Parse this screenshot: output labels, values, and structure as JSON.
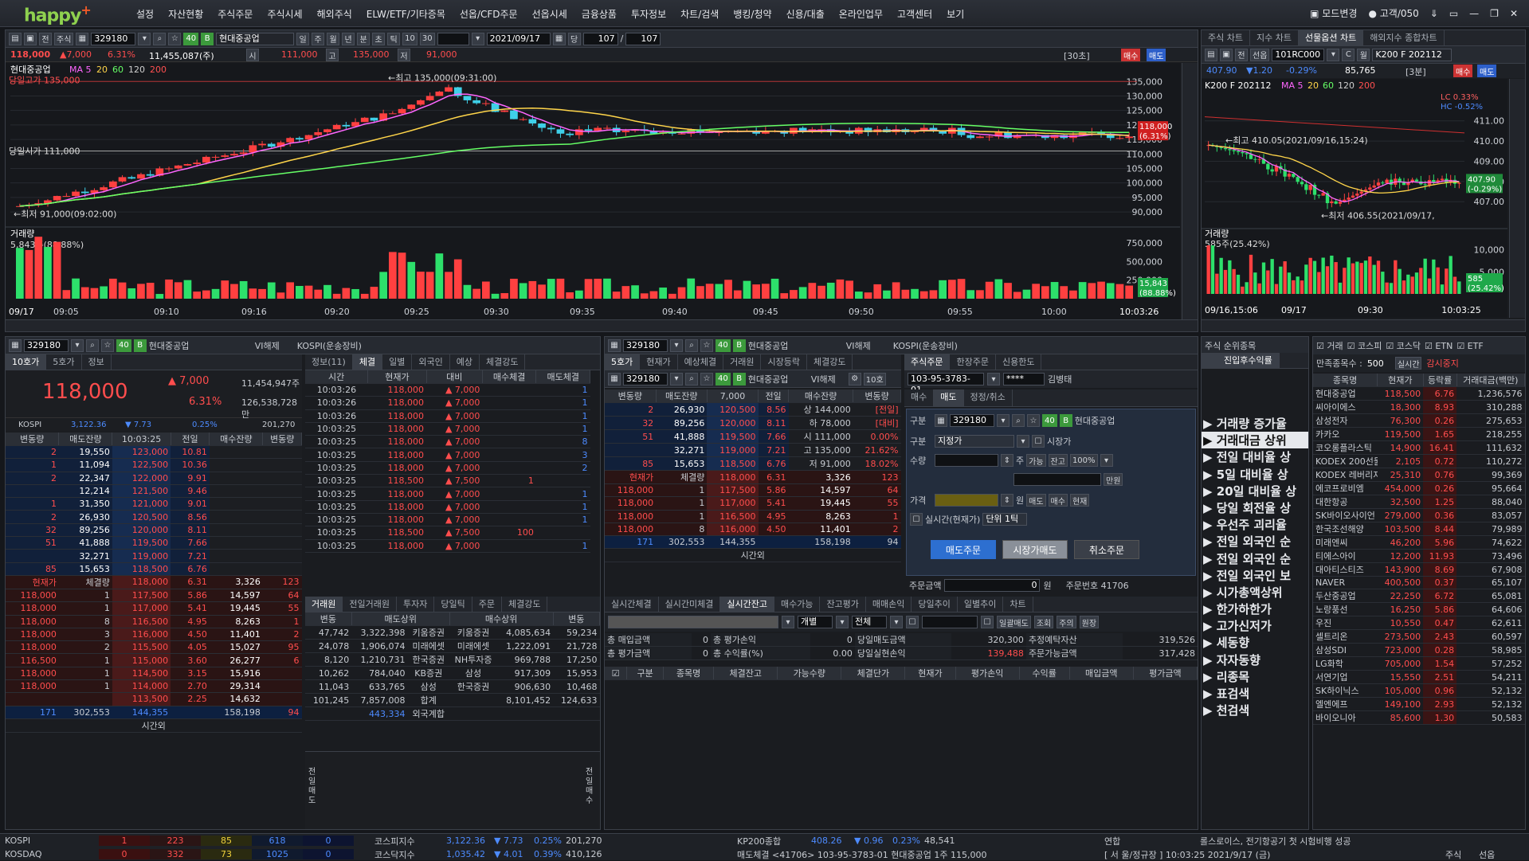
{
  "app": {
    "logo": "happy",
    "logo_plus": "+"
  },
  "menu": [
    "설정",
    "자산현황",
    "주식주문",
    "주식시세",
    "해외주식",
    "ELW/ETF/기타증목",
    "선옵/CFD주문",
    "선옵시세",
    "금융상품",
    "투자정보",
    "차트/검색",
    "뱅킹/청약",
    "신용/대출",
    "온라인업무",
    "고객센터",
    "보기"
  ],
  "menu_right": {
    "mode": "모드변경",
    "customer": "고객/050"
  },
  "main_chart": {
    "code": "329180",
    "name": "현대중공업",
    "count": "107",
    "count2": "107",
    "date": "2021/09/17",
    "unit": "당",
    "periods": [
      "일",
      "주",
      "월",
      "년",
      "분",
      "초",
      "틱"
    ],
    "p1": "10",
    "p2": "30",
    "price": "118,000",
    "change": "▲7,000",
    "pct": "6.31%",
    "volume": "11,455,087(주)",
    "open_label": "시",
    "open": "111,000",
    "high_label": "고",
    "high": "135,000",
    "low_label": "저",
    "low": "91,000",
    "interval": "[30초]",
    "buy": "매수",
    "sell": "매도",
    "legend_name": "현대중공업",
    "ma": [
      "MA 5",
      "20",
      "60",
      "120",
      "200"
    ],
    "high_note": "당일고가 135,000",
    "open_note": "당일시가 111,000",
    "max_note": "←최고 135,000(09:31:00)",
    "min_note": "←최저 91,000(09:02:00)",
    "yticks": [
      "135,000",
      "130,000",
      "125,000",
      "120,000",
      "115,000",
      "110,000",
      "105,000",
      "100,000",
      "95,000",
      "90,000"
    ],
    "cur_label": "118,000",
    "cur_pct": "(6.31%)",
    "vol_title": "거래량",
    "vol_note": "5,843주(88.88%)",
    "vol_ticks": [
      "750,000",
      "500,000",
      "250,000"
    ],
    "vol_cur": "15,843",
    "vol_cur_pct": "(88.88%)",
    "xticks": [
      "09/17",
      "09:05",
      "09:10",
      "09:16",
      "09:20",
      "09:25",
      "09:30",
      "09:35",
      "09:40",
      "09:45",
      "09:50",
      "09:55",
      "10:00",
      "10:03:26"
    ]
  },
  "side_chart": {
    "tabs": [
      "주식 차트",
      "지수 차트",
      "선물옵션 차트",
      "해외지수 종합차트"
    ],
    "code": "101RC000",
    "name": "K200 F 202112",
    "price": "407.90",
    "change": "▼1.20",
    "pct": "-0.29%",
    "vol": "85,765",
    "interval": "[3분]",
    "buy": "매수",
    "sell": "매도",
    "legend": "K200 F 202112",
    "ma": [
      "MA 5",
      "20",
      "60",
      "120",
      "200"
    ],
    "lc": "LC 0.33%",
    "hc": "HC -0.52%",
    "max_note": "←최고 410.05(2021/09/16,15:24)",
    "min_note": "←최저 406.55(2021/09/17,",
    "yticks": [
      "411.00",
      "410.00",
      "409.00",
      "408.00",
      "407.00"
    ],
    "cur": "407.90",
    "cur_pct": "(-0.29%)",
    "vol_title": "거래량",
    "vol_note": "585주(25.42%)",
    "vol_ticks": [
      "10,000",
      "5,000"
    ],
    "vol_cur": "585",
    "vol_cur_pct": "(25.42%)",
    "xticks": [
      "09/16,15:06",
      "09/17",
      "09:30",
      "10:03:25"
    ]
  },
  "orderbook": {
    "code": "329180",
    "name": "현대중공업",
    "vi": "VI해제",
    "market": "KOSPI(운송장비)",
    "tabs": [
      "10호가",
      "5호가",
      "정보"
    ],
    "price": "118,000",
    "change": "▲ 7,000",
    "pct": "6.31%",
    "vol": "11,454,947주",
    "amount": "126,538,728만",
    "kospi_label": "KOSPI",
    "kospi": "3,122.36",
    "kospi_chg": "▼ 7.73",
    "kospi_pct": "0.25%",
    "kospi_vol": "201,270",
    "hdr": [
      "변동량",
      "매도잔량",
      "10:03:25",
      "전일",
      "매수잔량",
      "변동량"
    ],
    "asks": [
      [
        "2",
        "19,550",
        "123,000",
        "10.81"
      ],
      [
        "1",
        "11,094",
        "122,500",
        "10.36"
      ],
      [
        "2",
        "22,347",
        "122,000",
        "9.91"
      ],
      [
        "",
        "12,214",
        "121,500",
        "9.46"
      ],
      [
        "1",
        "31,350",
        "121,000",
        "9.01"
      ],
      [
        "2",
        "26,930",
        "120,500",
        "8.56"
      ],
      [
        "32",
        "89,256",
        "120,000",
        "8.11"
      ],
      [
        "51",
        "41,888",
        "119,500",
        "7.66"
      ],
      [
        "",
        "32,271",
        "119,000",
        "7.21"
      ],
      [
        "85",
        "15,653",
        "118,500",
        "6.76"
      ]
    ],
    "bids": [
      [
        "118,000",
        "6.31",
        "3,326",
        "123"
      ],
      [
        "117,500",
        "5.86",
        "14,597",
        "64"
      ],
      [
        "117,000",
        "5.41",
        "19,445",
        "55"
      ],
      [
        "116,500",
        "4.95",
        "8,263",
        "1"
      ],
      [
        "116,000",
        "4.50",
        "11,401",
        "2"
      ],
      [
        "115,500",
        "4.05",
        "15,027",
        "95"
      ],
      [
        "115,000",
        "3.60",
        "26,277",
        "6"
      ],
      [
        "114,500",
        "3.15",
        "15,916",
        ""
      ],
      [
        "114,000",
        "2.70",
        "29,314",
        ""
      ],
      [
        "113,500",
        "2.25",
        "14,632",
        ""
      ]
    ],
    "trades_hdr": [
      "현재가",
      "체결량"
    ],
    "trades": [
      [
        "118,000",
        "1"
      ],
      [
        "118,000",
        "1"
      ],
      [
        "118,000",
        "1"
      ],
      [
        "118,000",
        "8"
      ],
      [
        "118,000",
        "3"
      ],
      [
        "118,000",
        "2"
      ],
      [
        "116,500",
        "1"
      ],
      [
        "118,000",
        "1"
      ],
      [
        "118,000",
        "1"
      ]
    ],
    "tot": [
      "171",
      "302,553",
      "144,355",
      "158,198",
      "94"
    ],
    "after": "시간외"
  },
  "ticks": {
    "tabs": [
      "정보(11)",
      "체결",
      "일별",
      "외국인",
      "예상",
      "체결강도"
    ],
    "hdr": [
      "시간",
      "현재가",
      "대비",
      "매수체결",
      "매도체결"
    ],
    "rows": [
      [
        "10:03:26",
        "118,000",
        "7,000",
        "",
        "1"
      ],
      [
        "10:03:26",
        "118,000",
        "7,000",
        "",
        "1"
      ],
      [
        "10:03:26",
        "118,000",
        "7,000",
        "",
        "1"
      ],
      [
        "10:03:25",
        "118,000",
        "7,000",
        "",
        "1"
      ],
      [
        "10:03:25",
        "118,000",
        "7,000",
        "",
        "8"
      ],
      [
        "10:03:25",
        "118,000",
        "7,000",
        "",
        "3"
      ],
      [
        "10:03:25",
        "118,000",
        "7,000",
        "",
        "2"
      ],
      [
        "10:03:25",
        "118,500",
        "7,500",
        "1",
        ""
      ],
      [
        "10:03:25",
        "118,000",
        "7,000",
        "",
        "1"
      ],
      [
        "10:03:25",
        "118,000",
        "7,000",
        "",
        "1"
      ],
      [
        "10:03:25",
        "118,000",
        "7,000",
        "",
        "1"
      ],
      [
        "10:03:25",
        "118,500",
        "7,500",
        "100",
        ""
      ],
      [
        "10:03:25",
        "118,000",
        "7,000",
        "",
        "1"
      ]
    ]
  },
  "broker": {
    "tabs": [
      "거래원",
      "전일거래원",
      "투자자",
      "당일틱",
      "주문",
      "체결강도"
    ],
    "hdr": [
      "변동",
      "매도상위",
      "매수상위",
      "변동"
    ],
    "rows": [
      [
        "47,742",
        "3,322,398",
        "키움증권",
        "키움증권",
        "4,085,634",
        "59,234"
      ],
      [
        "24,078",
        "1,906,074",
        "미래에셋",
        "미래에셋",
        "1,222,091",
        "21,728"
      ],
      [
        "8,120",
        "1,210,731",
        "한국증권",
        "NH투자증",
        "969,788",
        "17,250"
      ],
      [
        "10,262",
        "784,040",
        "KB증권",
        "삼성",
        "917,309",
        "15,953"
      ],
      [
        "11,043",
        "633,765",
        "삼성",
        "한국증권",
        "906,630",
        "10,468"
      ],
      [
        "101,245",
        "7,857,008",
        "합계",
        "",
        "8,101,452",
        "124,633"
      ],
      [
        "",
        "443,334",
        "외국계합",
        "",
        "",
        ""
      ]
    ],
    "left_v": "전일매도",
    "right_v": "전일매수"
  },
  "ob2": {
    "tabs": [
      "5호가",
      "현재가",
      "예상체결",
      "거래원",
      "시장등락",
      "체결강도"
    ],
    "code": "329180",
    "name": "현대중공업",
    "vi": "VI해제",
    "tick": "10호",
    "hdr": [
      "변동량",
      "매도잔량",
      "7,000",
      "전일",
      "매수잔량",
      "변동량"
    ],
    "asks": [
      [
        "2",
        "26,930",
        "120,500",
        "8.56"
      ],
      [
        "32",
        "89,256",
        "120,000",
        "8.11"
      ],
      [
        "51",
        "41,888",
        "119,500",
        "7.66"
      ],
      [
        "",
        "32,271",
        "119,000",
        "7.21"
      ],
      [
        "85",
        "15,653",
        "118,500",
        "6.76"
      ]
    ],
    "info": [
      [
        "상",
        "144,000"
      ],
      [
        "하",
        "78,000"
      ],
      [
        "시",
        "111,000"
      ],
      [
        "고",
        "135,000"
      ],
      [
        "저",
        "91,000"
      ]
    ],
    "info2": [
      "[전일]",
      "[대비]",
      "0.00%",
      "21.62%",
      "18.02%"
    ],
    "bids": [
      [
        "118,000",
        "6.31",
        "3,326",
        "123"
      ],
      [
        "117,500",
        "5.86",
        "14,597",
        "64"
      ],
      [
        "117,000",
        "5.41",
        "19,445",
        "55"
      ],
      [
        "116,500",
        "4.95",
        "8,263",
        "1"
      ],
      [
        "116,000",
        "4.50",
        "11,401",
        "2"
      ]
    ],
    "trades": [
      [
        "118,000",
        "1"
      ],
      [
        "118,000",
        "1"
      ],
      [
        "118,000",
        "1"
      ],
      [
        "118,000",
        "8"
      ]
    ],
    "tot": [
      "171",
      "302,553",
      "144,355",
      "158,198",
      "94"
    ],
    "after": "시간외"
  },
  "order": {
    "tabs": [
      "주식주문",
      "한장주문",
      "신용한도"
    ],
    "account": "103-95-3783-01",
    "pw": "****",
    "owner": "김병태",
    "sub": [
      "매수",
      "매도",
      "정정/취소"
    ],
    "modes": [
      "일반",
      "신용",
      "주의"
    ],
    "code": "329180",
    "name": "현대중공업",
    "type_label": "구분",
    "type": "지정가",
    "market_time": "시장가",
    "qty_label": "수량",
    "unit": "주",
    "avail": "가능",
    "bal": "잔고",
    "pct": "100%",
    "won_unit": "만원",
    "price_label": "가격",
    "won": "원",
    "sell_btn": "매도",
    "buy_btn": "매수",
    "cur_btn": "현재",
    "realtime": "실시간(현재가)",
    "tick_step": "단위 1틱",
    "btn_sell": "매도주문",
    "btn_mkt": "시장가매도",
    "btn_cancel": "취소주문",
    "amount_label": "주문금액",
    "amount": "0",
    "amount_unit": "원",
    "ordno": "주문번호 41706"
  },
  "balance": {
    "tabs": [
      "실시간체결",
      "실시간미체결",
      "실시간잔고",
      "매수가능",
      "잔고평가",
      "매매손익",
      "당일추이",
      "일별추이",
      "차트"
    ],
    "opt1": "개별",
    "opt2": "전체",
    "opt3": "일괄매도",
    "btn_q": "조회",
    "btn_n": "주의",
    "btn_w": "원장",
    "r1": [
      [
        "총 매입금액",
        "0"
      ],
      [
        "총 평가손익",
        "0"
      ],
      [
        "당일매도금액",
        "320,300"
      ],
      [
        "추정예탁자산",
        "319,526"
      ]
    ],
    "r2": [
      [
        "총 평가금액",
        "0"
      ],
      [
        "총 수익률(%)",
        "0.00"
      ],
      [
        "당일실현손익",
        "139,488"
      ],
      [
        "주문가능금액",
        "317,428"
      ]
    ],
    "hdr": [
      "구분",
      "종목명",
      "체결잔고",
      "가능수량",
      "체결단가",
      "현재가",
      "평가손익",
      "수익률",
      "매입금액",
      "평가금액"
    ]
  },
  "rank": {
    "title": "주식 순위종목",
    "tab": "진입후수익률",
    "items": [
      "거래량 증가율",
      "거래대금 상위",
      "전일 대비율 상",
      "5일 대비율 상",
      "20일 대비율 상",
      "당일 회전율 상",
      "우선주 괴리율",
      "전일 외국인 순",
      "전일 외국인 순",
      "전일 외국인 보",
      "시가총액상위",
      "한가하한가",
      "고가신저가",
      "세동향",
      "자자동향",
      "리종목",
      "표검색",
      "천검색"
    ]
  },
  "list": {
    "filters": [
      "거래",
      "코스피",
      "코스닥",
      "ETN",
      "ETF"
    ],
    "count_label": "만족종목수 :",
    "count": "500",
    "rt": "실시간",
    "stop": "감시중지",
    "hdr": [
      "종목명",
      "현재가",
      "등락률",
      "거래대금(백만)"
    ],
    "rows": [
      [
        "현대중공업",
        "118,500",
        "6.76",
        "1,236,576"
      ],
      [
        "씨아이에스",
        "18,300",
        "8.93",
        "310,288"
      ],
      [
        "삼성전자",
        "76,300",
        "0.26",
        "275,653"
      ],
      [
        "카카오",
        "119,500",
        "1.65",
        "218,255"
      ],
      [
        "코오롱플라스틱",
        "14,900",
        "16.41",
        "111,632"
      ],
      [
        "KODEX 200선물",
        "2,105",
        "0.72",
        "110,272"
      ],
      [
        "KODEX 레버리지",
        "25,310",
        "0.76",
        "99,369"
      ],
      [
        "에코프로비엠",
        "454,000",
        "0.26",
        "95,664"
      ],
      [
        "대한항공",
        "32,500",
        "1.25",
        "88,040"
      ],
      [
        "SK바이오사이언",
        "279,000",
        "0.36",
        "83,057"
      ],
      [
        "한국조선해양",
        "103,500",
        "8.44",
        "79,989"
      ],
      [
        "미래엔씨",
        "46,200",
        "5.96",
        "74,622"
      ],
      [
        "티에스아이",
        "12,200",
        "11.93",
        "73,496"
      ],
      [
        "대아티스티즈",
        "143,900",
        "8.69",
        "67,908"
      ],
      [
        "NAVER",
        "400,500",
        "0.37",
        "65,107"
      ],
      [
        "두산중공업",
        "22,250",
        "6.72",
        "65,081"
      ],
      [
        "노랑풍선",
        "16,250",
        "5.86",
        "64,606"
      ],
      [
        "우진",
        "10,550",
        "0.47",
        "62,611"
      ],
      [
        "셀트리온",
        "273,500",
        "2.43",
        "60,597"
      ],
      [
        "삼성SDI",
        "723,000",
        "0.28",
        "58,985"
      ],
      [
        "LG화학",
        "705,000",
        "1.54",
        "57,252"
      ],
      [
        "서연기업",
        "15,550",
        "2.51",
        "54,211"
      ],
      [
        "SK하이닉스",
        "105,000",
        "0.96",
        "52,132"
      ],
      [
        "엘엔에프",
        "149,100",
        "2.93",
        "52,132"
      ],
      [
        "바이오니아",
        "85,600",
        "1.30",
        "50,583"
      ]
    ]
  },
  "status": {
    "r1": {
      "label": "KOSPI",
      "a": "1",
      "b": "223",
      "c": "85",
      "d": "618",
      "e": "0",
      "idx_label": "코스피지수",
      "idx": "3,122.36",
      "idx_chg": "▼ 7.73",
      "idx_pct": "0.25%",
      "idx_vol": "201,270",
      "fut_label": "KP200종합",
      "fut": "408.26",
      "fut_chg": "▼ 0.96",
      "fut_pct": "0.23%",
      "fut_vol": "48,541",
      "news_label": "연합",
      "news": "롤스로이스, 전기항공기 첫 시험비행 성공"
    },
    "r2": {
      "label": "KOSDAQ",
      "a": "0",
      "b": "332",
      "c": "73",
      "d": "1025",
      "e": "0",
      "idx_label": "코스닥지수",
      "idx": "1,035.42",
      "idx_chg": "▼ 4.01",
      "idx_pct": "0.39%",
      "idx_vol": "410,126",
      "ord": "매도체결 <41706> 103-95-3783-01 현대중공업 1주 115,000",
      "time": "[ 서 울/정규장 ] 10:03:25 2021/9/17 (금)",
      "r1": "주식",
      "r2": "선옵"
    }
  }
}
